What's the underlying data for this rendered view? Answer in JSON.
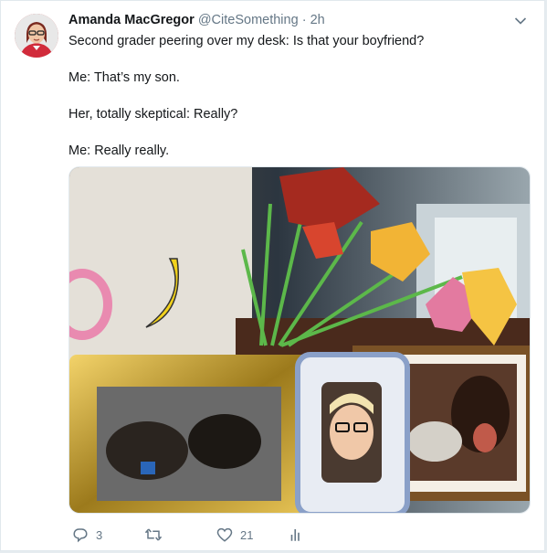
{
  "tweet": {
    "author_name": "Amanda MacGregor",
    "handle": "@CiteSomething",
    "separator": "·",
    "time": "2h",
    "paragraphs": [
      "Second grader peering over my desk: Is that your boyfriend?",
      "Me: That’s my son.",
      "Her, totally skeptical: Really?",
      "Me: Really really."
    ]
  },
  "media": {
    "icon": "photo-of-desk-with-framed-photos-and-paper-flowers"
  },
  "actions": {
    "reply_count": "3",
    "retweet_count": "",
    "like_count": "21",
    "icons": [
      "reply-icon",
      "retweet-icon",
      "like-icon",
      "analytics-icon"
    ]
  },
  "colors": {
    "text": "#14171a",
    "secondary": "#657786",
    "border": "#e1e8ed",
    "background": "#e6ecf0"
  }
}
